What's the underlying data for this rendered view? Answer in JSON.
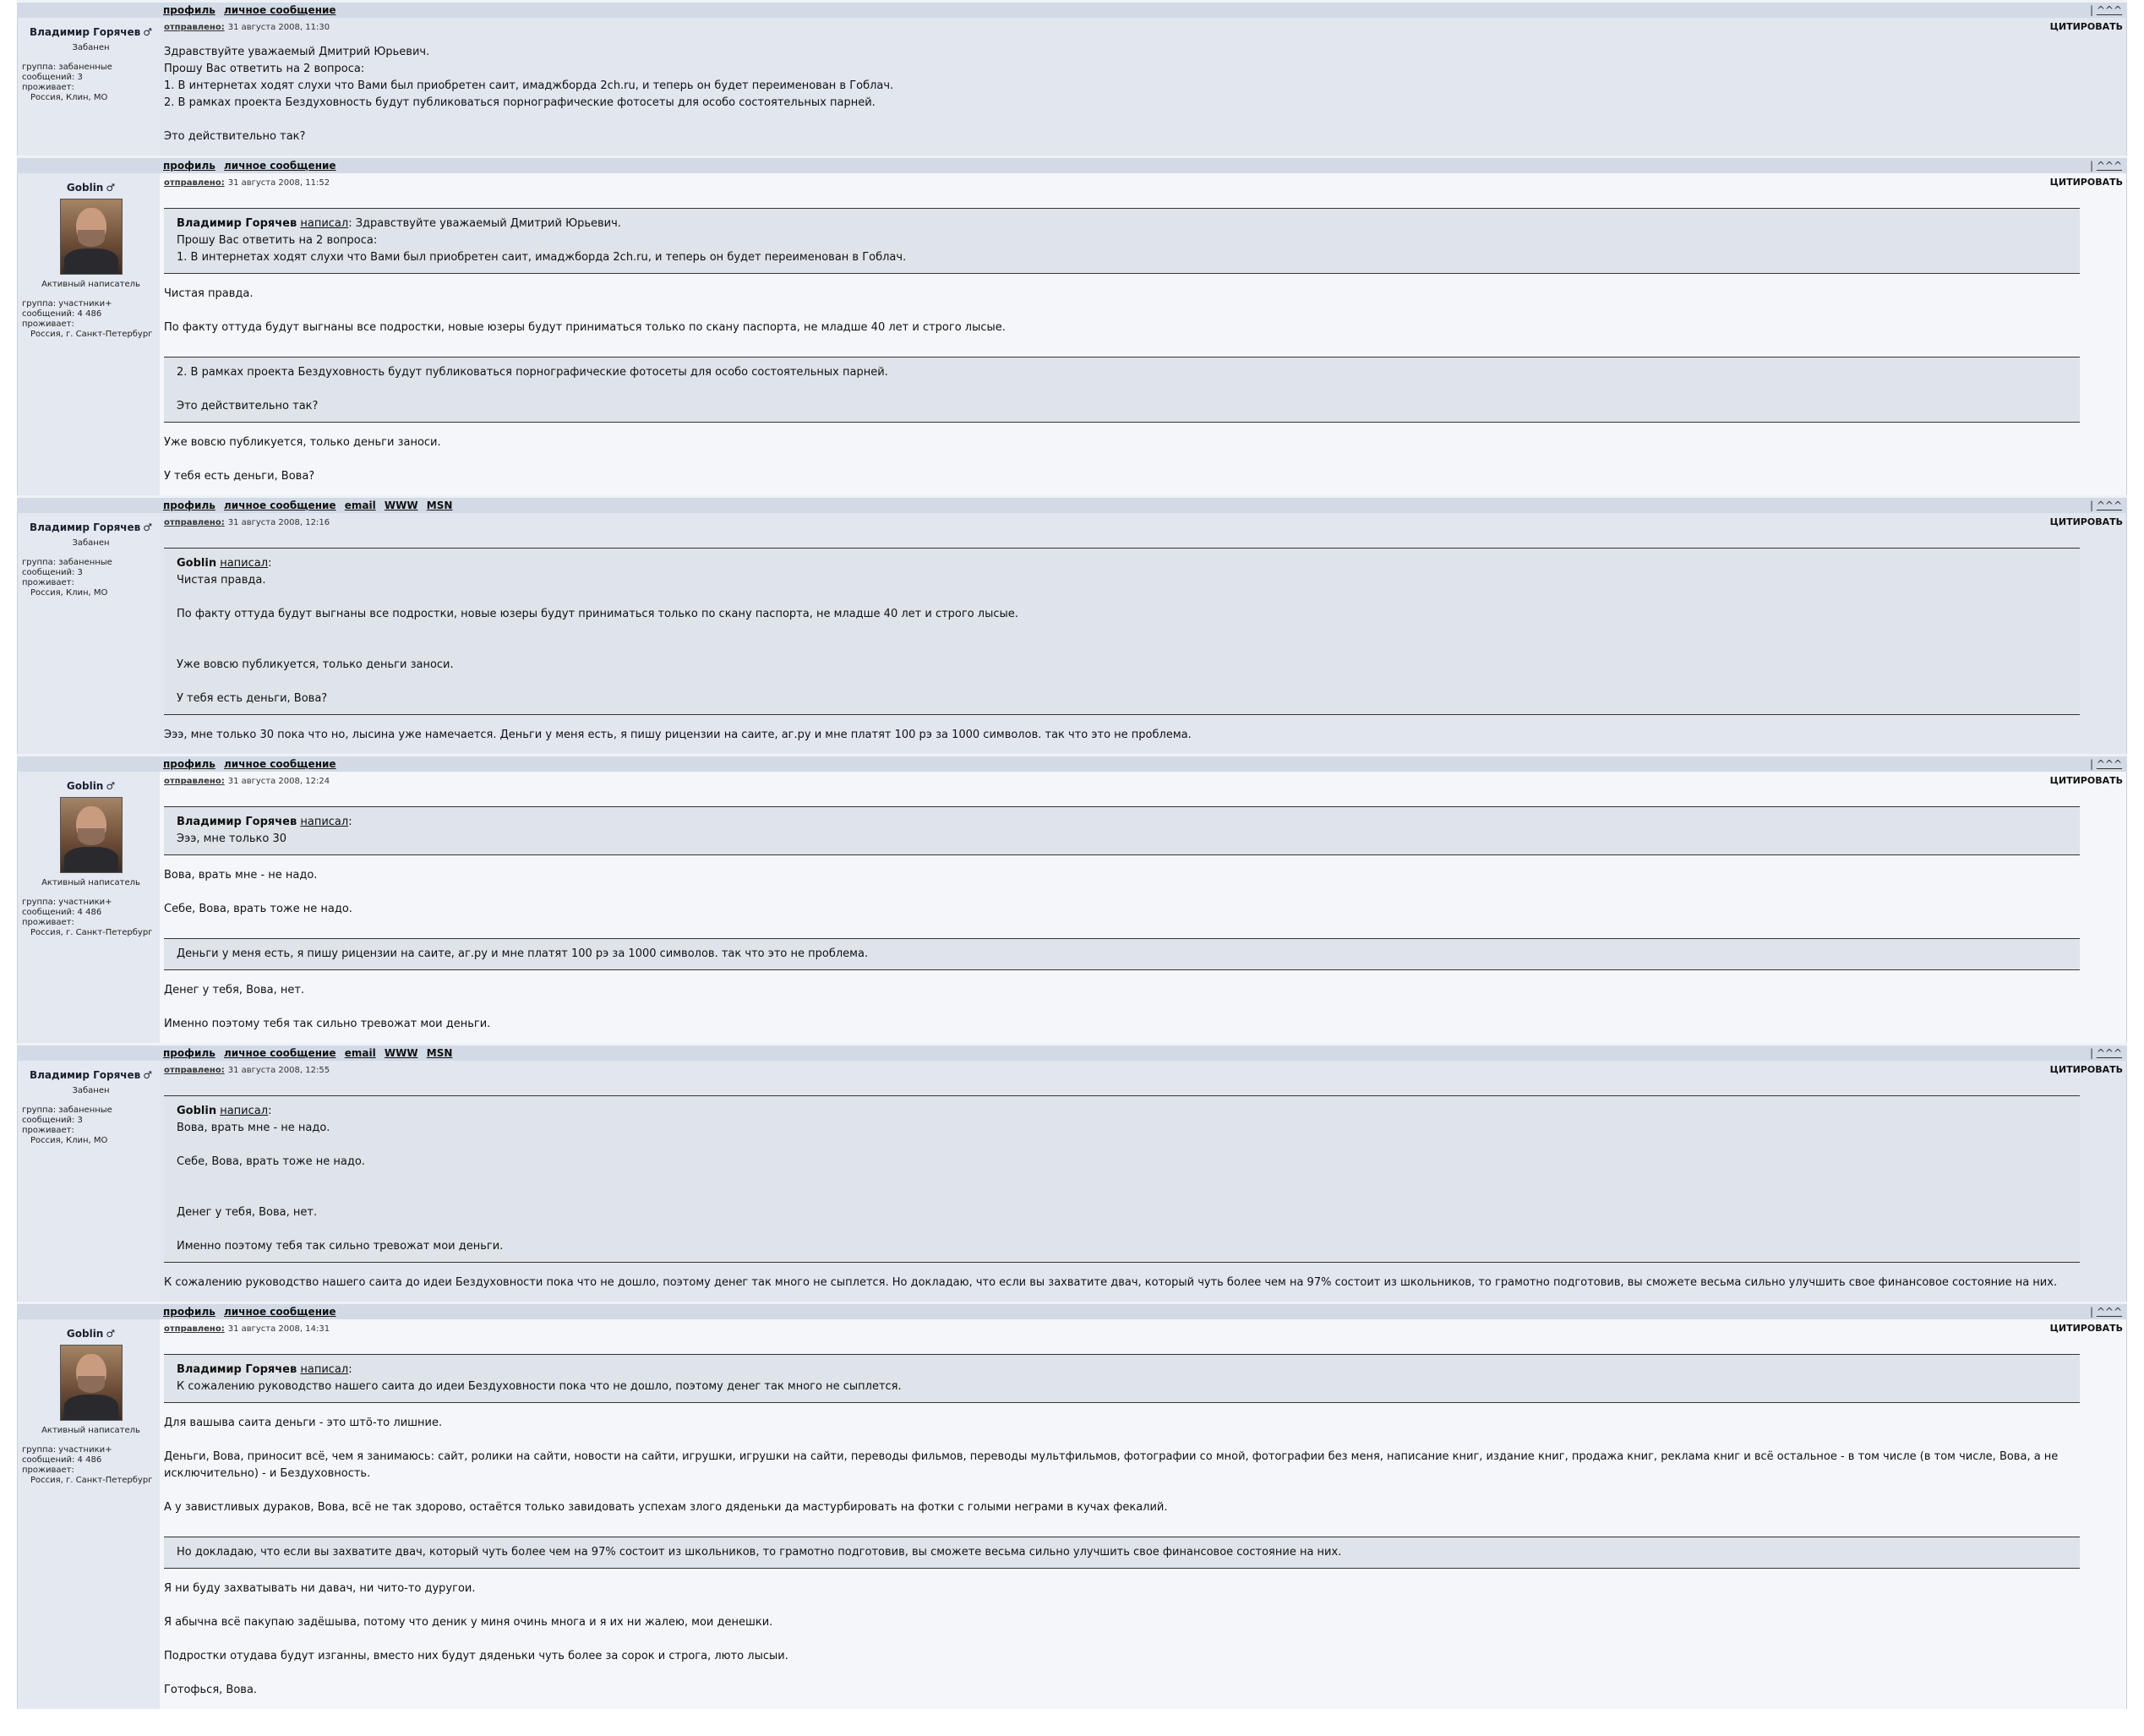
{
  "bar": {
    "profile": "профиль",
    "pm": "личное сообщение",
    "email": "email",
    "www": "WWW",
    "msn": "MSN",
    "separator": "|",
    "top": "^^^"
  },
  "common": {
    "sent_label": "отправлено:",
    "quote_label": "ЦИТИРОВАТЬ",
    "wrote": "написал",
    "male_sign": "♂"
  },
  "users": {
    "vladimir": {
      "nick": "Владимир Горячев",
      "rank": "Забанен",
      "group": "группа: забаненные",
      "posts": "сообщений: 3",
      "lives": "проживает:",
      "location": "Россия, Клин, МО"
    },
    "goblin": {
      "nick": "Goblin",
      "rank": "Активный написатель",
      "group": "группа: участники+",
      "posts": "сообщений: 4 486",
      "lives": "проживает:",
      "location": "Россия, г. Санкт-Петербург"
    }
  },
  "posts": [
    {
      "date": "31 августа 2008, 11:30",
      "paragraphs": [
        "Здравствуйте уважаемый Дмитрий Юрьевич.\nПрошу Вас ответить на 2 вопроса:\n1. В интернетах ходят слухи что Вами был приобретен саит, имаджборда 2ch.ru, и теперь он будет переименован в Гоблач.\n2. В рамках проекта Бездуховность будут публиковаться порнографические фотосеты для особо состоятельных парней.\n\nЭто действительно так?"
      ]
    },
    {
      "date": "31 августа 2008, 11:52",
      "quote1_author": "Владимир Горячев",
      "quote1_first": "Здравствуйте уважаемый Дмитрий Юрьевич.",
      "quote1_rest": "Прошу Вас ответить на 2 вопроса:\n1. В интернетах ходят слухи что Вами был приобретен саит, имаджборда 2ch.ru, и теперь он будет переименован в Гоблач.",
      "text1": "Чистая правда.\n\nПо факту оттуда будут выгнаны все подростки, новые юзеры будут приниматься только по скану паспорта, не младше 40 лет и строго лысые.",
      "quote2": "2. В рамках проекта Бездуховность будут публиковаться порнографические фотосеты для особо состоятельных парней.\n\nЭто действительно так?",
      "text2": "Уже вовсю публикуется, только деньги заноси.\n\nУ тебя есть деньги, Вова?"
    },
    {
      "date": "31 августа 2008, 12:16",
      "quote1_author": "Goblin",
      "quote1_body": "Чистая правда.\n\nПо факту оттуда будут выгнаны все подростки, новые юзеры будут приниматься только по скану паспорта, не младше 40 лет и строго лысые.\n\n\nУже вовсю публикуется, только деньги заноси.\n\nУ тебя есть деньги, Вова?",
      "text1": "Эээ, мне только 30 пока что но, лысина уже намечается. Деньги у меня есть, я пишу рицензии на саите, аг.ру и мне платят 100 рэ за 1000 символов. так что это не проблема."
    },
    {
      "date": "31 августа 2008, 12:24",
      "quote1_author": "Владимир Горячев",
      "quote1_body": "Эээ, мне только 30",
      "text1": "Вова, врать мне - не надо.\n\nСебе, Вова, врать тоже не надо.",
      "quote2": "Деньги у меня есть, я пишу рицензии на саите, аг.ру и мне платят 100 рэ за 1000 символов. так что это не проблема.",
      "text2": "Денег у тебя, Вова, нет.\n\nИменно поэтому тебя так сильно тревожат мои деньги."
    },
    {
      "date": "31 августа 2008, 12:55",
      "quote1_author": "Goblin",
      "quote1_body": "Вова, врать мне - не надо.\n\nСебе, Вова, врать тоже не надо.\n\n\nДенег у тебя, Вова, нет.\n\nИменно поэтому тебя так сильно тревожат мои деньги.",
      "text1": "К сожалению руководство нашего саита до идеи Бездуховности пока что не дошло, поэтому денег так много не сыплется. Но докладаю, что если вы захватите двач, который чуть более чем на 97% состоит из школьников, то грамотно подготовив, вы сможете весьма сильно улучшить свое финансовое состояние на них."
    },
    {
      "date": "31 августа 2008, 14:31",
      "quote1_author": "Владимир Горячев",
      "quote1_body": "К сожалению руководство нашего саита до идеи Бездуховности пока что не дошло, поэтому денег так много не сыплется.",
      "text1": "Для вашыва саита деньги - это штö-то лишние.\n\nДеньги, Вова, приносит всё, чем я занимаюсь: сайт, ролики на сайти, новости на сайти, игрушки, игрушки на сайти, переводы фильмов, переводы мультфильмов, фотографии со мной, фотографии без меня, написание книг, издание книг, продажа книг, реклама книг и всё остальное - в том числе (в том числе, Вова, а не исключительно) - и Бездуховность.\n\nА у завистливых дураков, Вова, всё не так здорово, остаётся только завидовать успехам злого дяденьки да мастурбировать на фотки с голыми неграми в кучах фекалий.",
      "quote2": "Но докладаю, что если вы захватите двач, который чуть более чем на 97% состоит из школьников, то грамотно подготовив, вы сможете весьма сильно улучшить свое финансовое состояние на них.",
      "text2": "Я ни буду захватывать ни давач, ни чито-то дуругои.\n\nЯ абычна всё пакупаю задёшыва, потому что деник у миня очинь многа и я их ни жалею, мои денешки.\n\nПодростки отудава будут изганны, вместо них будут дяденьки чуть более за сорок и строга, люто лысыи.\n\nГотофься, Вова."
    }
  ]
}
